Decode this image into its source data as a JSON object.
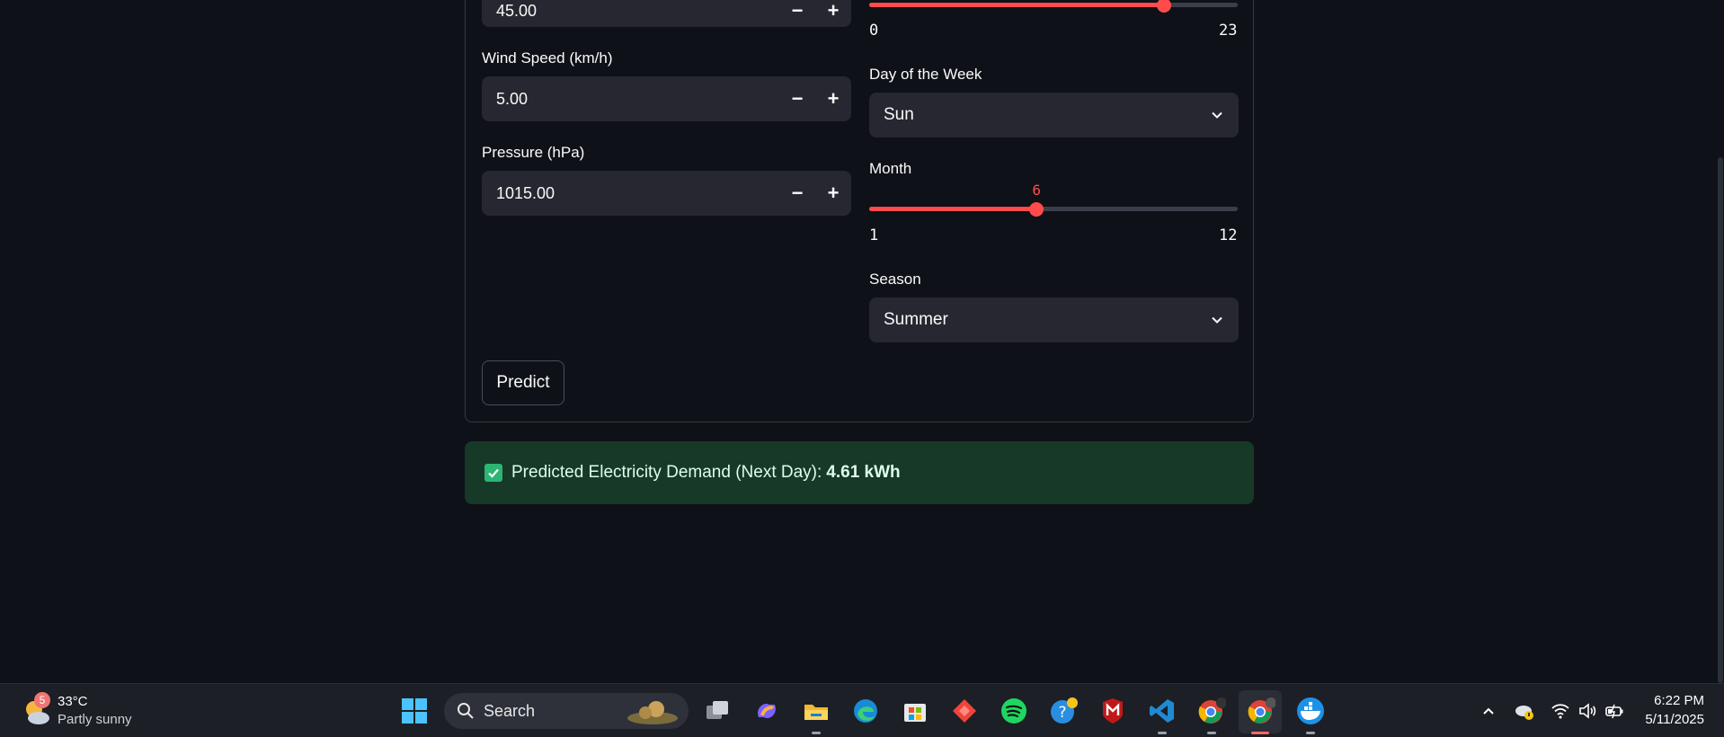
{
  "form": {
    "left": {
      "humidity": {
        "value": "45.00"
      },
      "wind": {
        "label": "Wind Speed (km/h)",
        "value": "5.00"
      },
      "pressure": {
        "label": "Pressure (hPa)",
        "value": "1015.00"
      },
      "minus": "−",
      "plus": "+"
    },
    "right": {
      "hour_slider": {
        "min": "0",
        "max": "23",
        "value_fraction": 0.8
      },
      "day": {
        "label": "Day of the Week",
        "value": "Sun"
      },
      "month": {
        "label": "Month",
        "value": "6",
        "min": "1",
        "max": "12",
        "value_fraction": 0.4545
      },
      "season": {
        "label": "Season",
        "value": "Summer"
      }
    },
    "predict_label": "Predict"
  },
  "result": {
    "text": "Predicted Electricity Demand (Next Day):",
    "value": "4.61 kWh"
  },
  "taskbar": {
    "weather": {
      "badge": "5",
      "temp": "33°C",
      "desc": "Partly sunny"
    },
    "search_placeholder": "Search",
    "clock": {
      "time": "6:22 PM",
      "date": "5/11/2025"
    },
    "accent": "#ff4b4b"
  }
}
